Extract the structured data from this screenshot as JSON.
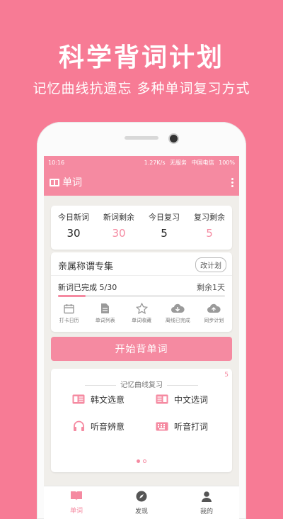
{
  "headline": "科学背词计划",
  "subheadline": "记忆曲线抗遗忘  多种单词复习方式",
  "status_bar": {
    "time": "10:16",
    "speed": "1.27K/s",
    "network": "无服务",
    "carrier": "中国电信",
    "battery": "100%"
  },
  "app_bar": {
    "title": "单词"
  },
  "stats": [
    {
      "label": "今日新词",
      "value": "30"
    },
    {
      "label": "新词剩余",
      "value": "30"
    },
    {
      "label": "今日复习",
      "value": "5"
    },
    {
      "label": "复习剩余",
      "value": "5"
    }
  ],
  "plan": {
    "title": "亲属称谓专集",
    "change_button": "改计划",
    "progress_label": "新词已完成 5/30",
    "remaining": "剩余1天",
    "progress": 0.167,
    "tools": [
      {
        "label": "打卡日历",
        "icon": "calendar-icon"
      },
      {
        "label": "单词列表",
        "icon": "document-icon"
      },
      {
        "label": "单词收藏",
        "icon": "star-icon"
      },
      {
        "label": "离线已完成",
        "icon": "cloud-download-icon"
      },
      {
        "label": "同步计划",
        "icon": "cloud-upload-icon"
      }
    ]
  },
  "start_button": "开始背单词",
  "review": {
    "badge": "5",
    "title": "记忆曲线复习",
    "modes": [
      {
        "label": "韩文选意",
        "icon": "card-icon"
      },
      {
        "label": "中文选词",
        "icon": "card-icon"
      },
      {
        "label": "听音辨意",
        "icon": "headphones-icon"
      },
      {
        "label": "听音打词",
        "icon": "keyboard-icon"
      }
    ]
  },
  "tabs": [
    {
      "label": "单词",
      "icon": "book-icon",
      "active": true
    },
    {
      "label": "发现",
      "icon": "compass-icon",
      "active": false
    },
    {
      "label": "我的",
      "icon": "person-icon",
      "active": false
    }
  ],
  "colors": {
    "accent": "#f58aa1",
    "background": "#f77b95"
  }
}
